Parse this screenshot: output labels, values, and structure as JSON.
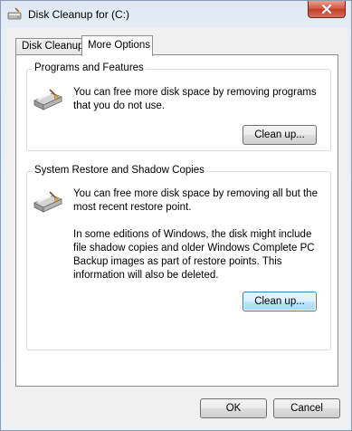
{
  "window": {
    "title": "Disk Cleanup for  (C:)",
    "close_glyph": "✕"
  },
  "tabs": [
    {
      "label": "Disk Cleanup",
      "active": false
    },
    {
      "label": "More Options",
      "active": true
    }
  ],
  "programs_group": {
    "legend": "Programs and Features",
    "description": "You can free more disk space by removing programs that you do not use.",
    "button_label": "Clean up..."
  },
  "restore_group": {
    "legend": "System Restore and Shadow Copies",
    "description": "You can free more disk space by removing all but the most recent restore point.",
    "note": "In some editions of Windows, the disk might include file shadow copies and older Windows Complete PC Backup images as part of restore points. This information will also be deleted.",
    "button_label": "Clean up..."
  },
  "footer": {
    "ok_label": "OK",
    "cancel_label": "Cancel"
  },
  "icons": {
    "app": "disk-cleanup-icon",
    "programs": "disk-drive-icon",
    "restore": "disk-drive-icon",
    "close": "close-icon"
  },
  "colors": {
    "close_button": "#c33b24",
    "focus_button": "#3c7fb1"
  }
}
